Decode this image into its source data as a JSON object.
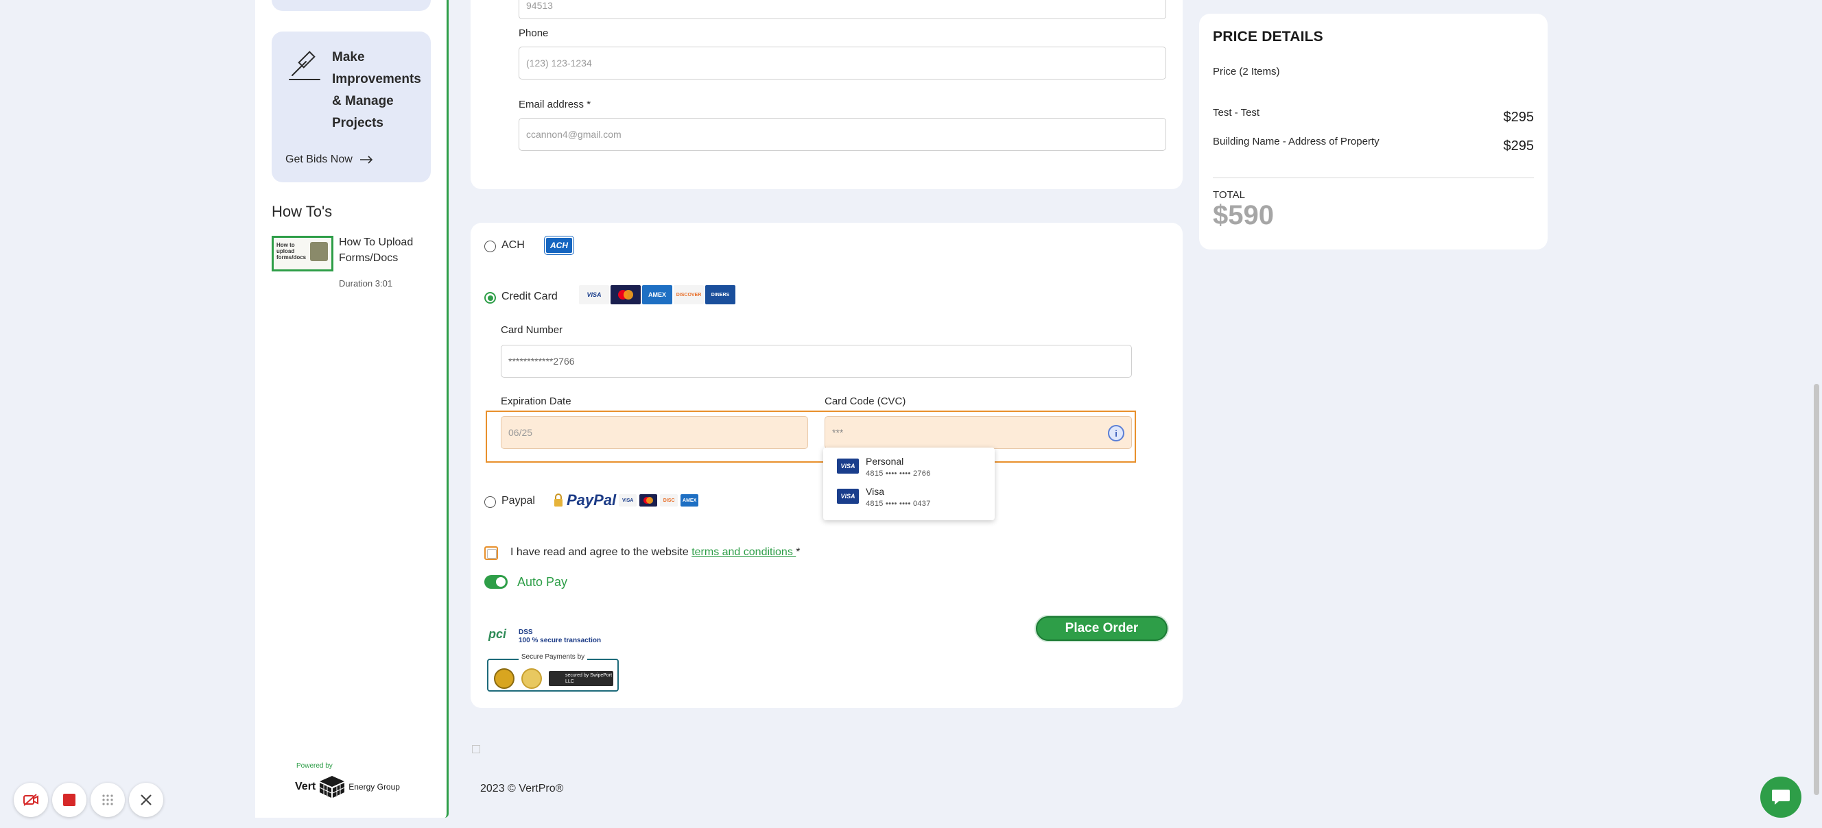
{
  "sidebar": {
    "improve_title": "Make Improvements & Manage Projects",
    "bids_link": "Get Bids Now",
    "howtos_title": "How To's",
    "howto": {
      "thumb_text": "How to upload forms/docs",
      "title": "How To Upload Forms/Docs",
      "duration": "Duration 3:01"
    },
    "powered_by": "Powered by",
    "brand_name": "Vert",
    "brand_suffix": "Energy Group"
  },
  "address_form": {
    "zip_value": "94513",
    "phone_label": "Phone",
    "phone_placeholder": "(123) 123-1234",
    "email_label": "Email address *",
    "email_value": "ccannon4@gmail.com"
  },
  "payment": {
    "ach_label": "ACH",
    "ach_logo": "ACH",
    "credit_card_label": "Credit Card",
    "card_logos": [
      "VISA",
      "MC",
      "AMEX",
      "DISCOVER",
      "DINERS"
    ],
    "card_number_label": "Card Number",
    "card_number_value": "************2766",
    "expiration_label": "Expiration Date",
    "expiration_value": "06/25",
    "cvc_label": "Card Code (CVC)",
    "cvc_value": "***",
    "saved_cards": [
      {
        "name": "Personal",
        "number": "4815 •••• •••• 2766",
        "brand": "VISA"
      },
      {
        "name": "Visa",
        "number": "4815 •••• •••• 0437",
        "brand": "VISA"
      }
    ],
    "paypal_label": "Paypal",
    "paypal_logo": "PayPal",
    "terms_prefix": "I have read and agree to the website ",
    "terms_link": "terms and conditions ",
    "terms_required": "*",
    "autopay_label": "Auto Pay",
    "autopay_on": true,
    "place_order": "Place Order",
    "pci_line1": "DSS",
    "pci_line2": "100 % secure transaction",
    "secure_title": "Secure Payments by",
    "secured_by_text": "secured by SwipePort LLC"
  },
  "price_details": {
    "title": "PRICE DETAILS",
    "count": "Price (2 Items)",
    "items": [
      {
        "name": "Test - Test",
        "price": "$295"
      },
      {
        "name": "Building Name - Address of Property",
        "price": "$295"
      }
    ],
    "total_label": "TOTAL",
    "total_value": "$590"
  },
  "footer": {
    "copyright": "2023 © VertPro®"
  },
  "colors": {
    "accent_green": "#2e9e48",
    "highlight_orange": "#e8902c",
    "page_bg": "#eef1f8"
  }
}
